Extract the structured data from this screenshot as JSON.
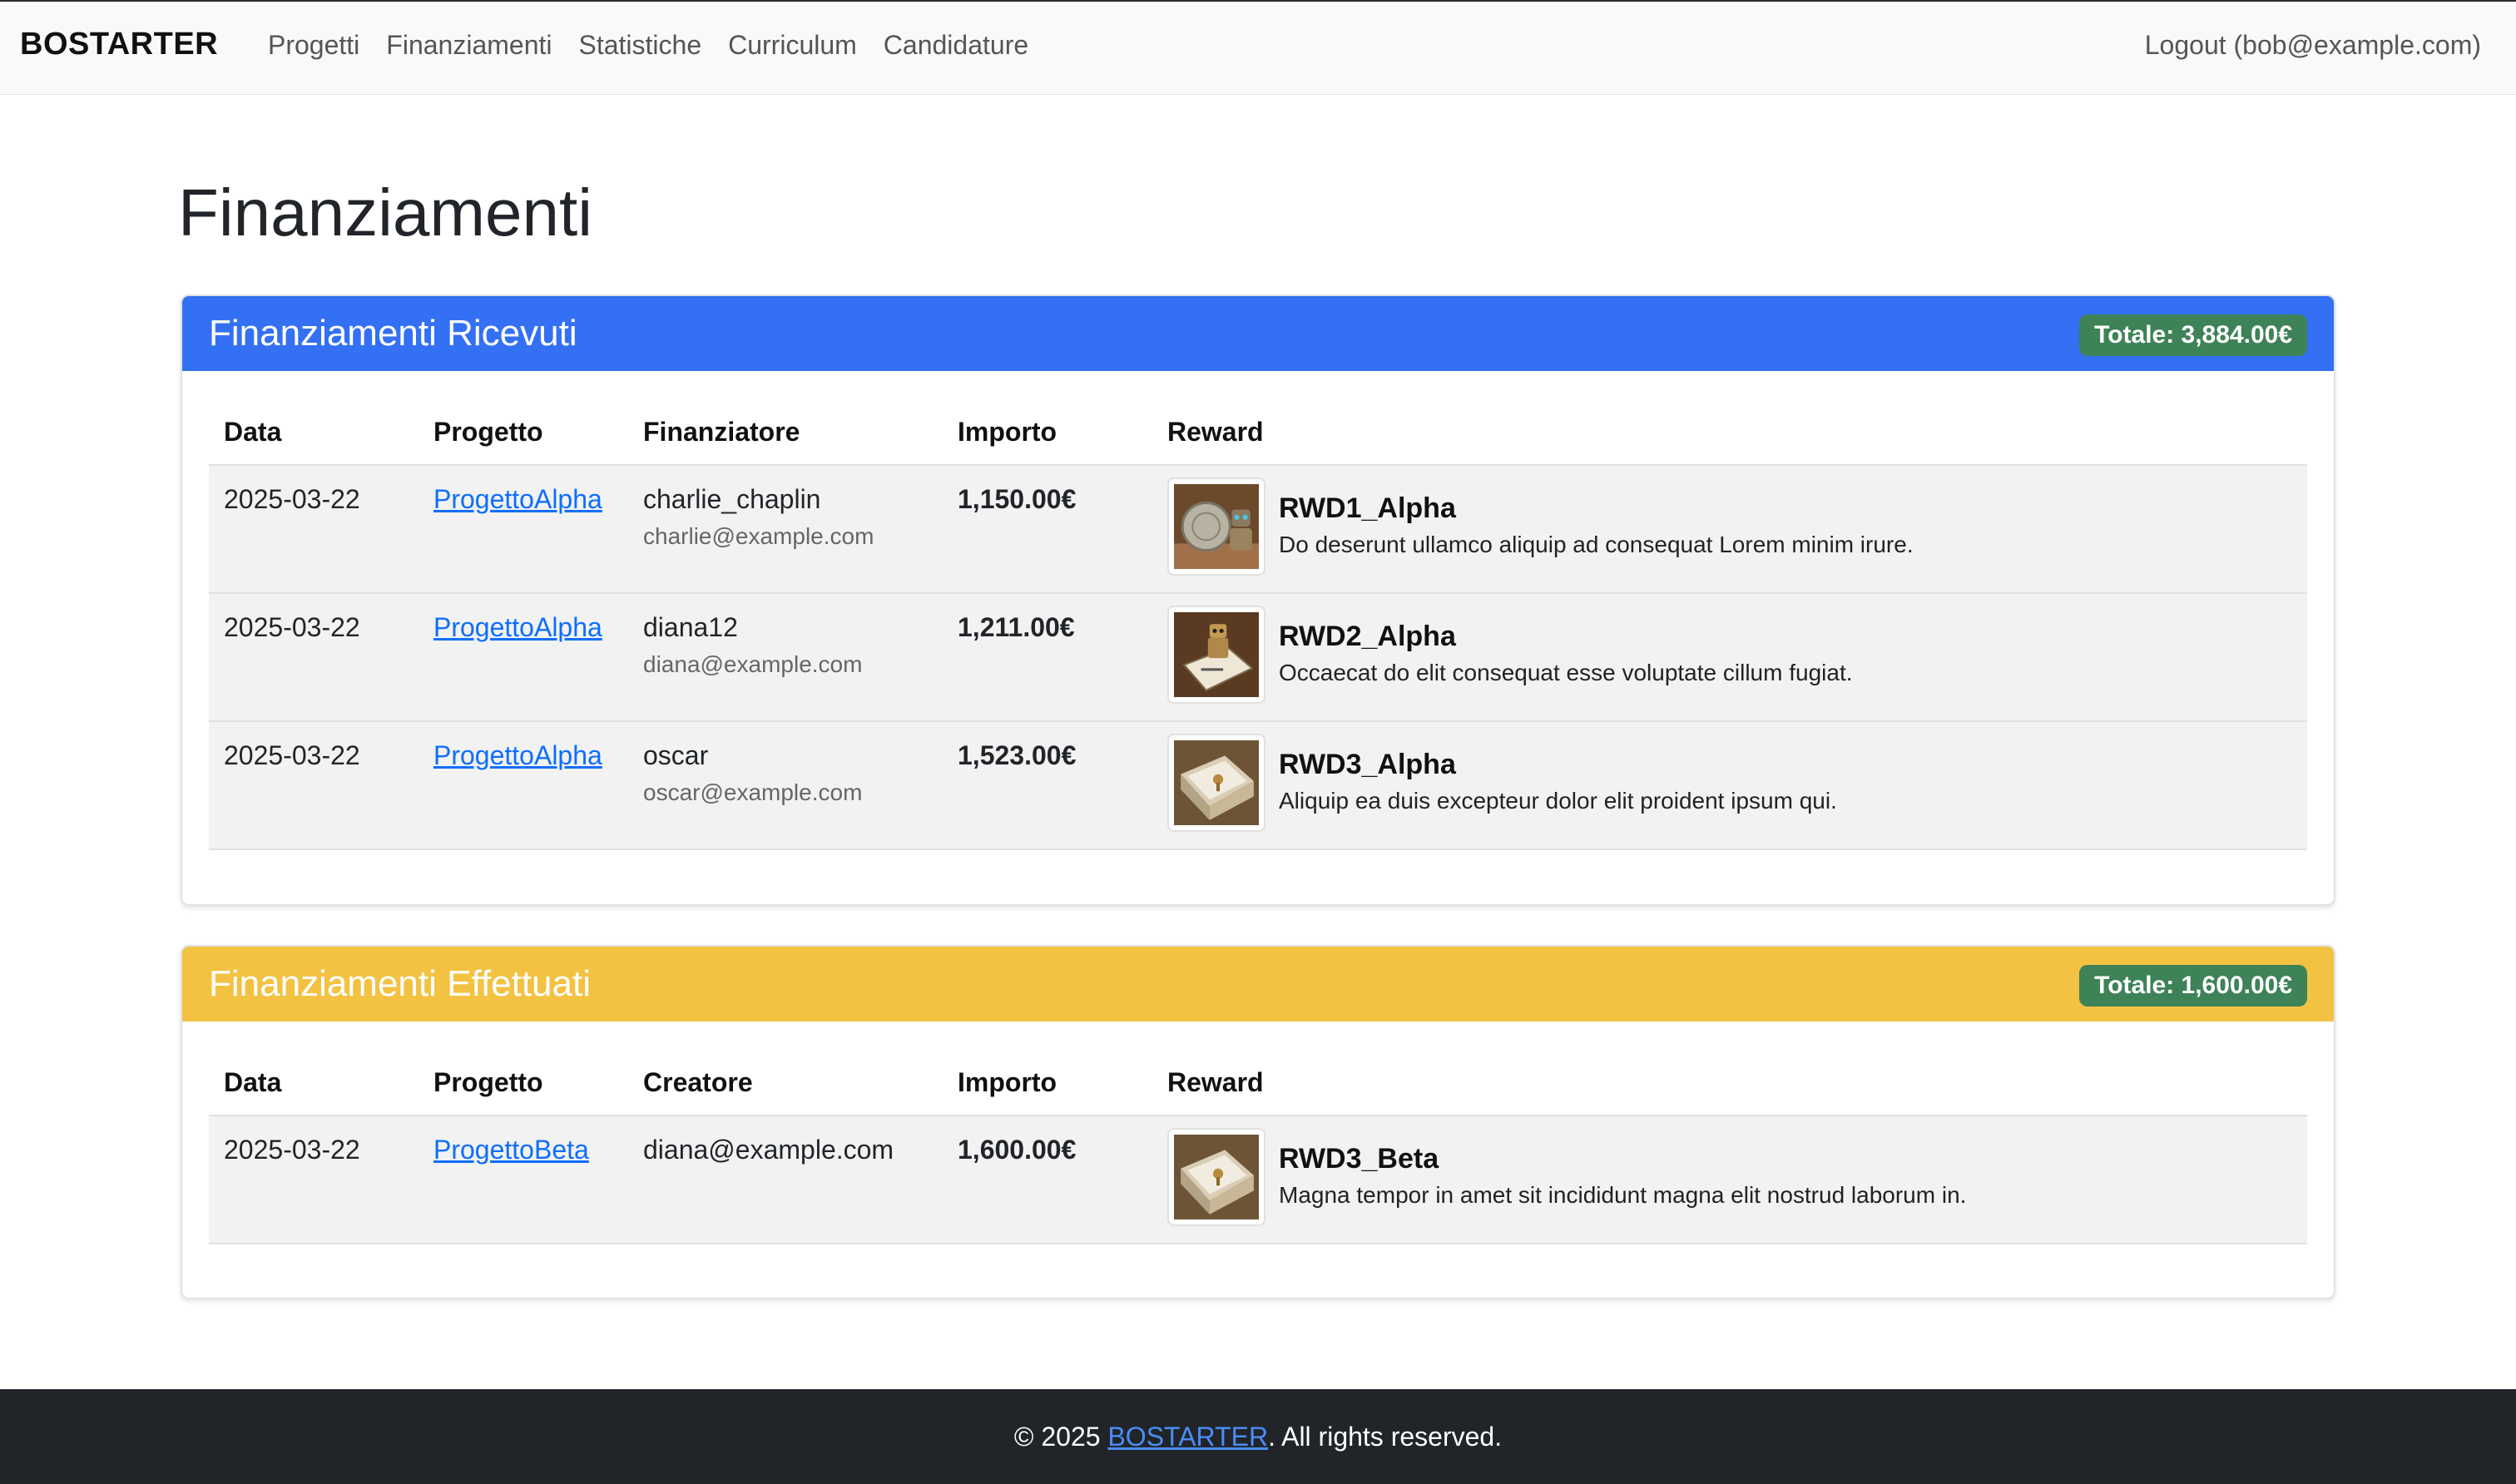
{
  "navbar": {
    "brand": "BOSTARTER",
    "links": [
      "Progetti",
      "Finanziamenti",
      "Statistiche",
      "Curriculum",
      "Candidature"
    ],
    "logout": "Logout (bob@example.com)"
  },
  "page": {
    "title": "Finanziamenti"
  },
  "received": {
    "title": "Finanziamenti Ricevuti",
    "total": "Totale: 3,884.00€",
    "headers": [
      "Data",
      "Progetto",
      "Finanziatore",
      "Importo",
      "Reward"
    ],
    "rows": [
      {
        "date": "2025-03-22",
        "project": "ProgettoAlpha",
        "funder": "charlie_chaplin",
        "email": "charlie@example.com",
        "amount": "1,150.00€",
        "reward_name": "RWD1_Alpha",
        "reward_desc": "Do deserunt ullamco aliquip ad consequat Lorem minim irure.",
        "reward_icon": "coin-robot-image"
      },
      {
        "date": "2025-03-22",
        "project": "ProgettoAlpha",
        "funder": "diana12",
        "email": "diana@example.com",
        "amount": "1,211.00€",
        "reward_name": "RWD2_Alpha",
        "reward_desc": "Occaecat do elit consequat esse voluptate cillum fugiat.",
        "reward_icon": "robot-card-image"
      },
      {
        "date": "2025-03-22",
        "project": "ProgettoAlpha",
        "funder": "oscar",
        "email": "oscar@example.com",
        "amount": "1,523.00€",
        "reward_name": "RWD3_Alpha",
        "reward_desc": "Aliquip ea duis excepteur dolor elit proident ipsum qui.",
        "reward_icon": "thank-you-box-image"
      }
    ]
  },
  "made": {
    "title": "Finanziamenti Effettuati",
    "total": "Totale: 1,600.00€",
    "headers": [
      "Data",
      "Progetto",
      "Creatore",
      "Importo",
      "Reward"
    ],
    "rows": [
      {
        "date": "2025-03-22",
        "project": "ProgettoBeta",
        "creator": "diana@example.com",
        "amount": "1,600.00€",
        "reward_name": "RWD3_Beta",
        "reward_desc": "Magna tempor in amet sit incididunt magna elit nostrud laborum in.",
        "reward_icon": "thank-you-box-image"
      }
    ]
  },
  "footer": {
    "prefix": "© 2025 ",
    "brand": "BOSTARTER",
    "suffix": ". All rights reserved."
  },
  "colors": {
    "received_header": "#3470f3",
    "made_header": "#f3c242",
    "badge": "#3e8257",
    "footer_bg": "#212529"
  }
}
